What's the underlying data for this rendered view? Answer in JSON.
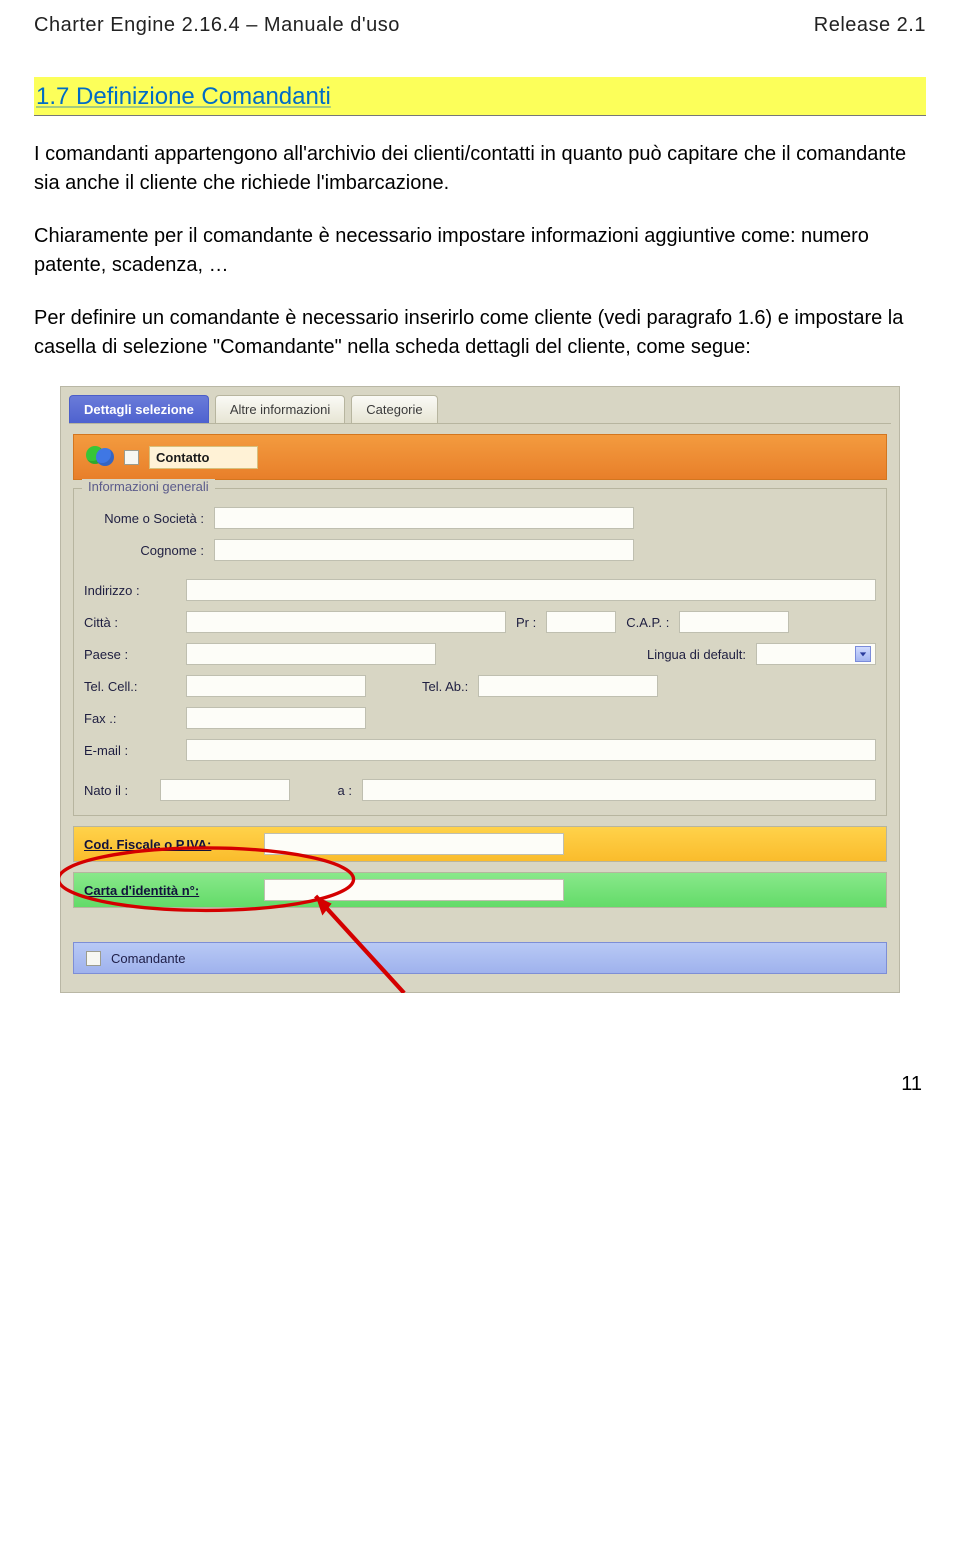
{
  "header": {
    "left": "Charter Engine 2.16.4 – Manuale d'uso",
    "right": "Release 2.1"
  },
  "section": {
    "heading": "1.7  Definizione Comandanti",
    "p1": "I comandanti appartengono all'archivio dei clienti/contatti in quanto può capitare che il comandante sia anche il cliente che richiede l'imbarcazione.",
    "p2": "Chiaramente per il comandante è necessario impostare informazioni aggiuntive come: numero patente, scadenza, …",
    "p3": "Per definire un comandante è necessario inserirlo come cliente (vedi paragrafo 1.6) e impostare la casella di selezione \"Comandante\" nella scheda dettagli del cliente, come segue:"
  },
  "tabs": {
    "active": "Dettagli selezione",
    "t2": "Altre informazioni",
    "t3": "Categorie"
  },
  "contatto": {
    "label": "Contatto"
  },
  "info": {
    "title": "Informazioni generali",
    "nome": "Nome o Società :",
    "cognome": "Cognome :",
    "indirizzo": "Indirizzo :",
    "citta": "Città :",
    "pr": "Pr :",
    "cap": "C.A.P. :",
    "paese": "Paese :",
    "lingua": "Lingua di default:",
    "cell": "Tel. Cell.:",
    "telab": "Tel. Ab.:",
    "fax": "Fax .:",
    "email": "E-mail :",
    "nato": "Nato il :",
    "a": "a :"
  },
  "bands": {
    "fiscale": "Cod. Fiscale o P.IVA:",
    "carta": "Carta d'identità n°:"
  },
  "comandante": {
    "label": "Comandante"
  },
  "page_number": "11"
}
